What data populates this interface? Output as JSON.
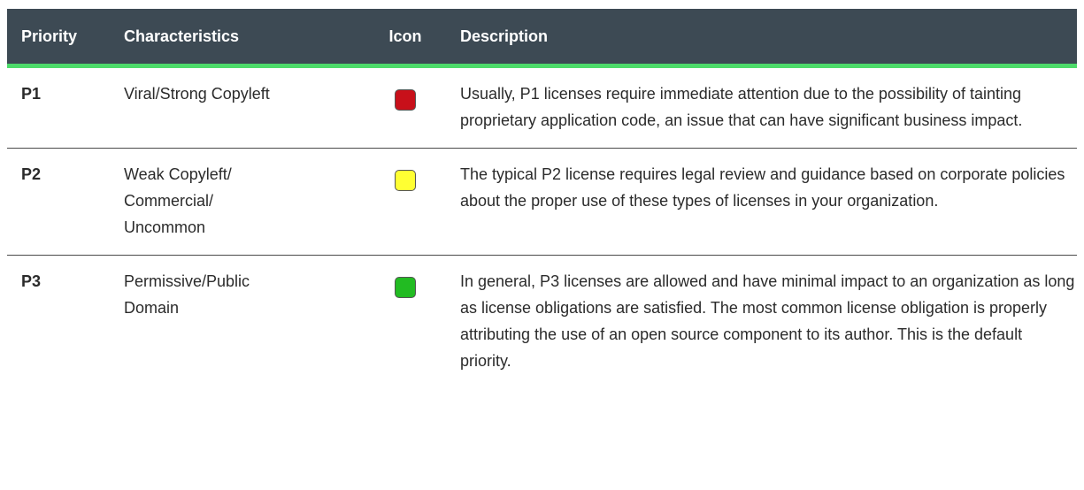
{
  "table": {
    "headers": {
      "priority": "Priority",
      "characteristics": "Characteristics",
      "icon": "Icon",
      "description": "Description"
    },
    "accent_color": "#4ddb6a",
    "header_color": "#3d4a54",
    "rows": [
      {
        "priority": "P1",
        "characteristics": "Viral/Strong Copyleft",
        "icon": "red-square-icon",
        "icon_color": "#c8101a",
        "description": "Usually, P1 licenses require immediate attention due to the possibility of tainting proprietary application code, an issue that can have significant business impact."
      },
      {
        "priority": "P2",
        "characteristics": "Weak Copyleft/\nCommercial/\nUncommon",
        "icon": "yellow-square-icon",
        "icon_color": "#ffff33",
        "description": "The typical P2 license requires legal review and guidance based on corporate policies about the proper use of these types of licenses in your organization."
      },
      {
        "priority": "P3",
        "characteristics": "Permissive/Public\nDomain",
        "icon": "green-square-icon",
        "icon_color": "#22bb22",
        "description": "In general, P3 licenses are allowed and have minimal impact to an organization as long as license obligations are satisfied. The most common license obligation is properly attributing the use of an open source component to its author. This is the default priority."
      }
    ]
  }
}
